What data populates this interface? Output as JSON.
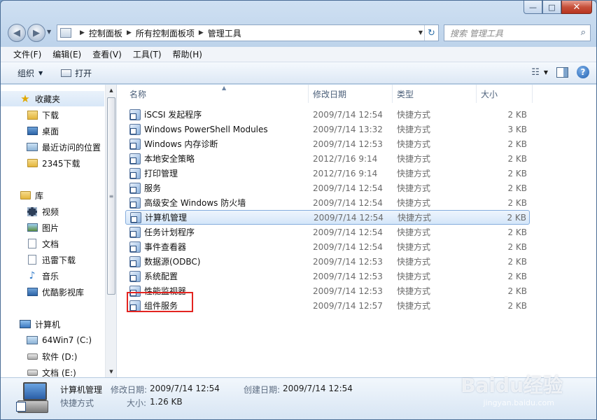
{
  "window": {
    "minimize_glyph": "—",
    "maximize_glyph": "□",
    "close_glyph": "✕"
  },
  "address": {
    "breadcrumbs": [
      "控制面板",
      "所有控制面板项",
      "管理工具"
    ],
    "search_placeholder": "搜索 管理工具"
  },
  "menu": [
    "文件(F)",
    "编辑(E)",
    "查看(V)",
    "工具(T)",
    "帮助(H)"
  ],
  "toolbar": {
    "organize_label": "组织",
    "open_label": "打开"
  },
  "navpane": {
    "favorites_label": "收藏夹",
    "favorites": [
      "下载",
      "桌面",
      "最近访问的位置",
      "2345下载"
    ],
    "libraries_label": "库",
    "libraries": [
      "视频",
      "图片",
      "文档",
      "迅雷下载",
      "音乐",
      "优酷影视库"
    ],
    "computer_label": "计算机",
    "drives": [
      "64Win7  (C:)",
      "软件 (D:)",
      "文档 (E:)"
    ]
  },
  "columns": {
    "name": "名称",
    "date": "修改日期",
    "type": "类型",
    "size": "大小"
  },
  "files": [
    {
      "name": "iSCSI 发起程序",
      "date": "2009/7/14 12:54",
      "type": "快捷方式",
      "size": "2 KB"
    },
    {
      "name": "Windows PowerShell Modules",
      "date": "2009/7/14 13:32",
      "type": "快捷方式",
      "size": "3 KB"
    },
    {
      "name": "Windows 内存诊断",
      "date": "2009/7/14 12:53",
      "type": "快捷方式",
      "size": "2 KB"
    },
    {
      "name": "本地安全策略",
      "date": "2012/7/16 9:14",
      "type": "快捷方式",
      "size": "2 KB"
    },
    {
      "name": "打印管理",
      "date": "2012/7/16 9:14",
      "type": "快捷方式",
      "size": "2 KB"
    },
    {
      "name": "服务",
      "date": "2009/7/14 12:54",
      "type": "快捷方式",
      "size": "2 KB"
    },
    {
      "name": "高级安全 Windows 防火墙",
      "date": "2009/7/14 12:54",
      "type": "快捷方式",
      "size": "2 KB"
    },
    {
      "name": "计算机管理",
      "date": "2009/7/14 12:54",
      "type": "快捷方式",
      "size": "2 KB",
      "selected": true
    },
    {
      "name": "任务计划程序",
      "date": "2009/7/14 12:54",
      "type": "快捷方式",
      "size": "2 KB"
    },
    {
      "name": "事件查看器",
      "date": "2009/7/14 12:54",
      "type": "快捷方式",
      "size": "2 KB"
    },
    {
      "name": "数据源(ODBC)",
      "date": "2009/7/14 12:53",
      "type": "快捷方式",
      "size": "2 KB"
    },
    {
      "name": "系统配置",
      "date": "2009/7/14 12:53",
      "type": "快捷方式",
      "size": "2 KB"
    },
    {
      "name": "性能监视器",
      "date": "2009/7/14 12:53",
      "type": "快捷方式",
      "size": "2 KB"
    },
    {
      "name": "组件服务",
      "date": "2009/7/14 12:57",
      "type": "快捷方式",
      "size": "2 KB"
    }
  ],
  "details": {
    "name": "计算机管理",
    "type": "快捷方式",
    "modified_label": "修改日期:",
    "modified_value": "2009/7/14 12:54",
    "created_label": "创建日期:",
    "created_value": "2009/7/14 12:54",
    "size_label": "大小:",
    "size_value": "1.26 KB"
  },
  "watermark": {
    "brand": "Baidu经验",
    "url": "jingyan.baidu.com"
  },
  "colors": {
    "selection_border": "#84acdd",
    "highlight_box": "#e32420"
  }
}
